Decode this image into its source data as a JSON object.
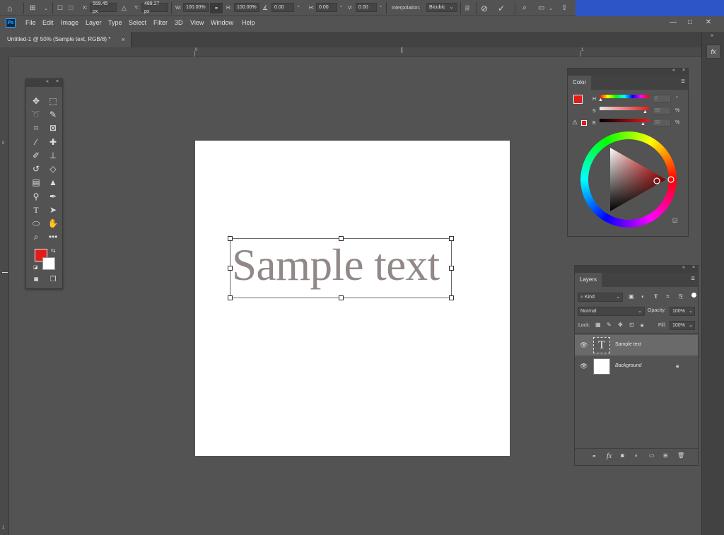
{
  "options_bar": {
    "x_label": "X:",
    "x_value": "559.45 px",
    "y_label": "Y:",
    "y_value": "488.27 px",
    "w_label": "W:",
    "w_value": "100.00%",
    "h_label": "H:",
    "h_value": "100.00%",
    "angle_value": "0.00",
    "deg": "°",
    "hskew_label": "H:",
    "hskew_value": "0.00",
    "vskew_label": "V:",
    "vskew_value": "0.00",
    "interp_label": "Interpolation:",
    "interp_value": "Bicubic"
  },
  "menu": [
    "File",
    "Edit",
    "Image",
    "Layer",
    "Type",
    "Select",
    "Filter",
    "3D",
    "View",
    "Window",
    "Help"
  ],
  "app_badge": "Ps",
  "window_controls": {
    "minimize": "—",
    "maximize": "□",
    "close": "✕"
  },
  "document_tab": {
    "title": "Untitled-1 @ 50% (Sample text, RGB/8) *",
    "close": "×"
  },
  "rulers": {
    "top_0": "0",
    "top_1": "1",
    "left_0": "0",
    "left_1": "1"
  },
  "canvas": {
    "text": "Sample text"
  },
  "colors": {
    "foreground": "#e31b1b",
    "background": "#ffffff",
    "text_color": "#918887",
    "accent_blue": "#2d55c8"
  },
  "color_panel": {
    "tab": "Color",
    "h_label": "H",
    "h_value": "0",
    "h_unit": "°",
    "s_label": "S",
    "s_value": "95",
    "s_unit": "%",
    "b_label": "B",
    "b_value": "90",
    "b_unit": "%"
  },
  "layers_panel": {
    "tab": "Layers",
    "kind_label": "Kind",
    "blend_mode": "Normal",
    "opacity_label": "Opacity:",
    "opacity_value": "100%",
    "lock_label": "Lock:",
    "fill_label": "Fill:",
    "fill_value": "100%",
    "layers": [
      {
        "name": "Sample text",
        "type": "text",
        "selected": true,
        "thumb_glyph": "T"
      },
      {
        "name": "Background",
        "type": "pixel",
        "selected": false,
        "locked": true
      }
    ],
    "footer_fx": "fx"
  },
  "dock": {
    "fx": "fx"
  }
}
